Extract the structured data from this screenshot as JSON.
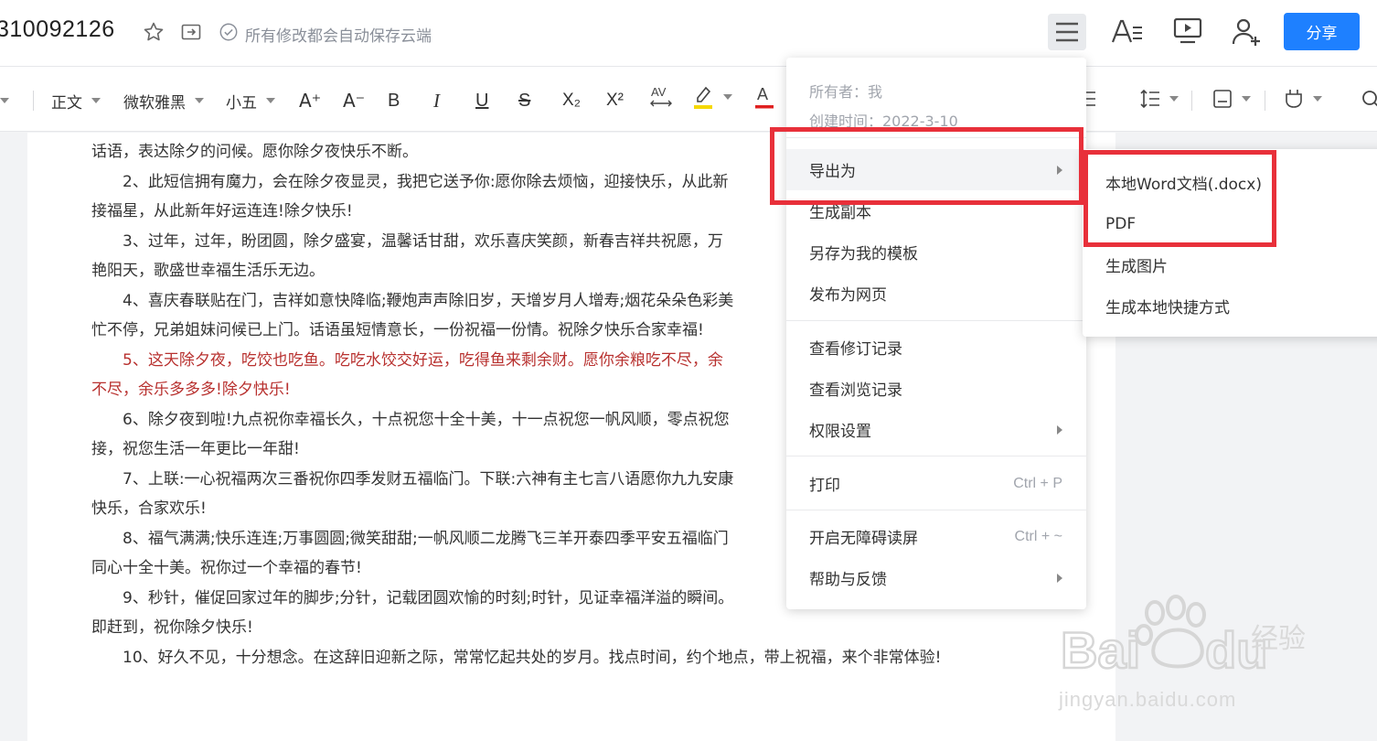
{
  "header": {
    "doc_title": "310092126",
    "autosave_text": "所有修改都会自动保存云端",
    "share_label": "分享"
  },
  "toolbar": {
    "style_value": "正文",
    "font_value": "微软雅黑",
    "size_value": "小五",
    "increase_font": "A⁺",
    "decrease_font": "A⁻",
    "bold": "B",
    "italic": "I",
    "underline": "U",
    "strike": "S",
    "subscript": "X₂",
    "superscript": "X²"
  },
  "document": {
    "paragraphs": [
      {
        "lines": [
          "话语，表达除夕的问候。愿你除夕夜快乐不断。"
        ],
        "first": true
      },
      {
        "lines": [
          "2、此短信拥有魔力，会在除夕夜显灵，我把它送予你:愿你除去烦恼，迎接快乐，从此新",
          "接福星，从此新年好运连连!除夕快乐!"
        ]
      },
      {
        "lines": [
          "3、过年，过年，盼团圆，除夕盛宴，温馨话甘甜，欢乐喜庆笑颜，新春吉祥共祝愿，万",
          "艳阳天，歌盛世幸福生活乐无边。"
        ]
      },
      {
        "lines": [
          "4、喜庆春联贴在门，吉祥如意快降临;鞭炮声声除旧岁，天增岁月人增寿;烟花朵朵色彩美",
          "忙不停，兄弟姐妹问候已上门。话语虽短情意长，一份祝福一份情。祝除夕快乐合家幸福!"
        ]
      },
      {
        "lines": [
          "5、这天除夕夜，吃饺也吃鱼。吃吃水饺交好运，吃得鱼来剩余财。愿你余粮吃不尽，余",
          "不尽，余乐多多多!除夕快乐!"
        ],
        "red": true
      },
      {
        "lines": [
          "6、除夕夜到啦!九点祝你幸福长久，十点祝您十全十美，十一点祝您一帆风顺，零点祝您",
          "接，祝您生活一年更比一年甜!"
        ]
      },
      {
        "lines": [
          "7、上联:一心祝福两次三番祝你四季发财五福临门。下联:六神有主七言八语愿你九九安康",
          "快乐，合家欢乐!"
        ]
      },
      {
        "lines": [
          "8、福气满满;快乐连连;万事圆圆;微笑甜甜;一帆风顺二龙腾飞三羊开泰四季平安五福临门",
          "同心十全十美。祝你过一个幸福的春节!"
        ]
      },
      {
        "lines": [
          "9、秒针，催促回家过年的脚步;分针，记载团圆欢愉的时刻;时针，见证幸福洋溢的瞬间。",
          "即赶到，祝你除夕快乐!"
        ]
      },
      {
        "lines": [
          "10、好久不见，十分想念。在这辞旧迎新之际，常常忆起共处的岁月。找点时间，约个地点，带上祝福，来个非常体验!"
        ]
      }
    ]
  },
  "menu": {
    "owner": "所有者：我",
    "created": "创建时间：2022-3-10",
    "items": [
      {
        "label": "导出为",
        "arrow": true
      },
      {
        "label": "生成副本"
      },
      {
        "label": "另存为我的模板"
      },
      {
        "label": "发布为网页"
      },
      {
        "label": "查看修订记录"
      },
      {
        "label": "查看浏览记录"
      },
      {
        "label": "权限设置",
        "arrow": true
      },
      {
        "label": "打印",
        "shortcut": "Ctrl + P"
      },
      {
        "label": "开启无障碍读屏",
        "shortcut": "Ctrl + ~"
      },
      {
        "label": "帮助与反馈",
        "arrow": true
      }
    ]
  },
  "submenu": {
    "items": [
      {
        "label": "本地Word文档(.docx)"
      },
      {
        "label": "PDF"
      },
      {
        "label": "生成图片"
      },
      {
        "label": "生成本地快捷方式"
      }
    ]
  },
  "watermark": {
    "text": "jingyan.baidu.com"
  },
  "colors": {
    "accent": "#1e80ff",
    "highlight_box": "#e8303a",
    "red_text": "#b8312f"
  }
}
